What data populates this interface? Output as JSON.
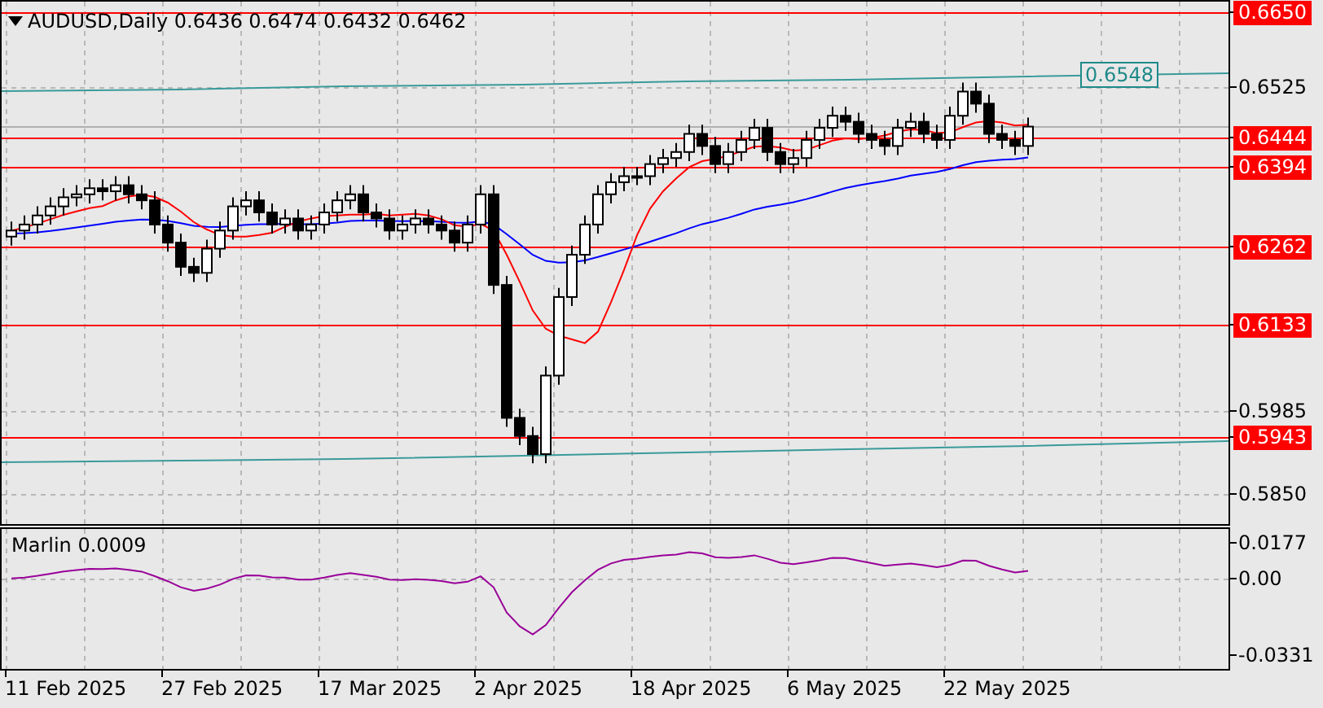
{
  "chart": {
    "title": "AUDUSD,Daily 0.6436 0.6474 0.6432 0.6462",
    "channel_label": "0.6548",
    "price_axis": [
      {
        "label": "0.6650",
        "kind": "level"
      },
      {
        "label": "0.6525",
        "kind": "tick"
      },
      {
        "label": "0.6444",
        "kind": "level"
      },
      {
        "label": "0.6394",
        "kind": "level"
      },
      {
        "label": "0.6262",
        "kind": "level"
      },
      {
        "label": "0.6133",
        "kind": "level"
      },
      {
        "label": "0.5985",
        "kind": "tick"
      },
      {
        "label": "0.5943",
        "kind": "level"
      },
      {
        "label": "0.5850",
        "kind": "tick"
      }
    ]
  },
  "indicator": {
    "label": "Marlin 0.0009",
    "axis": [
      "0.0177",
      "0.00",
      "-0.0331"
    ]
  },
  "dates": [
    "11 Feb 2025",
    "27 Feb 2025",
    "17 Mar 2025",
    "2 Apr 2025",
    "18 Apr 2025",
    "6 May 2025",
    "22 May 2025"
  ]
}
